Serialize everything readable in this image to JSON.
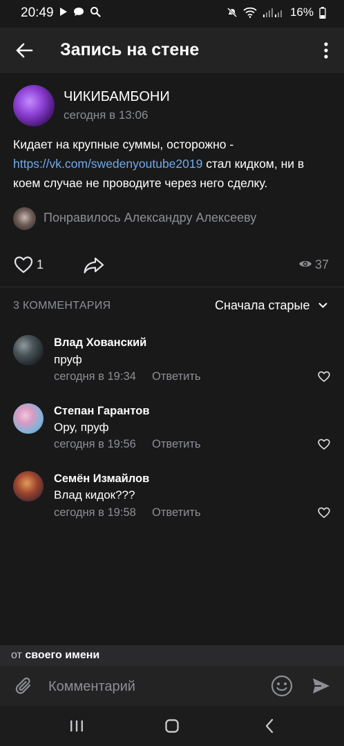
{
  "status_bar": {
    "time": "20:49",
    "battery": "16%"
  },
  "header": {
    "title": "Запись на стене"
  },
  "post": {
    "group_name": "ЧИКИБАМБОНИ",
    "time": "сегодня в 13:06",
    "text_before_link": "Кидает на крупные суммы, осторожно - ",
    "link_text": "https://vk.com/swedenyoutube2019",
    "text_after_link": " стал кидком, ни в коем случае не проводите через него сделку.",
    "liked_by": "Понравилось Александру Алексееву",
    "likes_count": "1",
    "views_count": "37"
  },
  "comments_section": {
    "count_label": "3 КОММЕНТАРИЯ",
    "sort_label": "Сначала старые",
    "comments": [
      {
        "author": "Влад Хованский",
        "text": "пруф",
        "time": "сегодня в 19:34",
        "reply_label": "Ответить"
      },
      {
        "author": "Степан Гарантов",
        "text": "Ору, пруф",
        "time": "сегодня в 19:56",
        "reply_label": "Ответить"
      },
      {
        "author": "Семён Измайлов",
        "text": "Влад кидок???",
        "time": "сегодня в 19:58",
        "reply_label": "Ответить"
      }
    ]
  },
  "composer": {
    "identity_prefix": "от",
    "identity_name": "своего имени",
    "placeholder": "Комментарий"
  },
  "colors": {
    "accent_link": "#71aaeb",
    "background": "#19191a",
    "header": "#232324"
  }
}
